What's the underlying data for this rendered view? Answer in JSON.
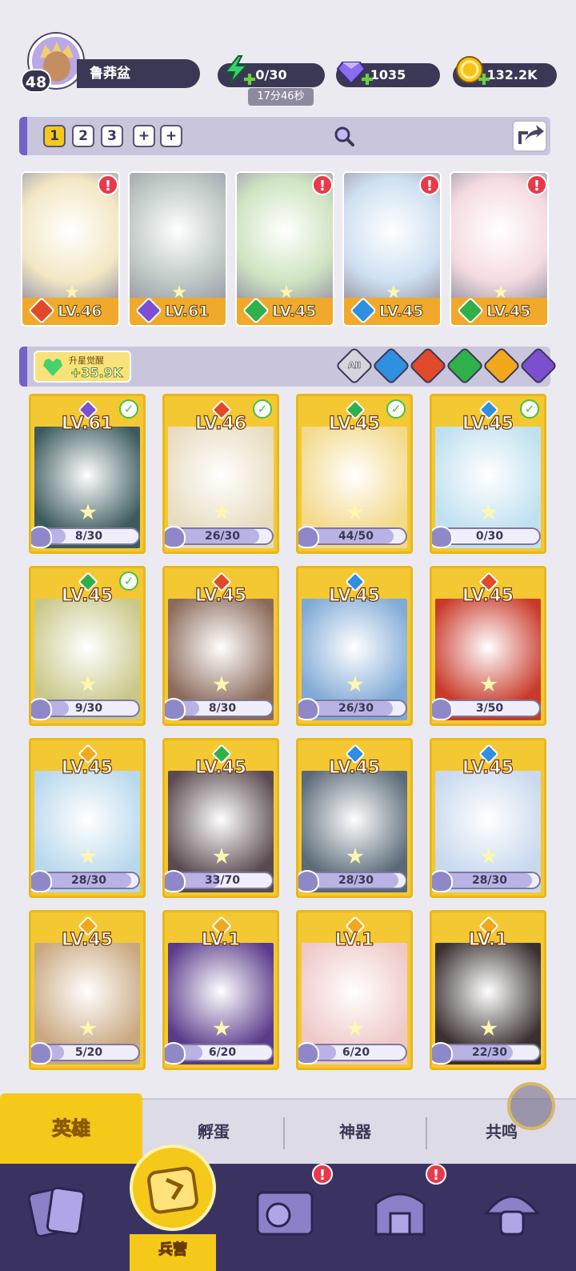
{
  "player": {
    "level": "48",
    "name": "鲁莽盆"
  },
  "resources": {
    "energy": "0/30",
    "energy_timer": "17分46秒",
    "gems": "1035",
    "gold": "132.2K"
  },
  "team_tabs": [
    "1",
    "2",
    "3",
    "+",
    "+"
  ],
  "team": [
    {
      "level": "LV.46",
      "element": "fire",
      "alert": true
    },
    {
      "level": "LV.61",
      "element": "dark",
      "alert": false
    },
    {
      "level": "LV.45",
      "element": "nature",
      "alert": true
    },
    {
      "level": "LV.45",
      "element": "water",
      "alert": true
    },
    {
      "level": "LV.45",
      "element": "nature",
      "alert": true
    }
  ],
  "awaken": {
    "label": "升星觉醒",
    "value": "+35.9K"
  },
  "filters": [
    "All",
    "water",
    "fire",
    "nature",
    "light",
    "dark"
  ],
  "heroes": [
    {
      "level": "LV.61",
      "element": "dark",
      "progress": "8/30",
      "fraction": 0.27,
      "checked": true
    },
    {
      "level": "LV.46",
      "element": "fire",
      "progress": "26/30",
      "fraction": 0.87,
      "checked": true
    },
    {
      "level": "LV.45",
      "element": "nature",
      "progress": "44/50",
      "fraction": 0.88,
      "checked": true
    },
    {
      "level": "LV.45",
      "element": "water",
      "progress": "0/30",
      "fraction": 0,
      "checked": true
    },
    {
      "level": "LV.45",
      "element": "nature",
      "progress": "9/30",
      "fraction": 0.3,
      "checked": true
    },
    {
      "level": "LV.45",
      "element": "fire",
      "progress": "8/30",
      "fraction": 0.27,
      "checked": false
    },
    {
      "level": "LV.45",
      "element": "water",
      "progress": "26/30",
      "fraction": 0.87,
      "checked": false
    },
    {
      "level": "LV.45",
      "element": "fire",
      "progress": "3/50",
      "fraction": 0.06,
      "checked": false
    },
    {
      "level": "LV.45",
      "element": "light",
      "progress": "28/30",
      "fraction": 0.93,
      "checked": false
    },
    {
      "level": "LV.45",
      "element": "nature",
      "progress": "33/70",
      "fraction": 0.47,
      "checked": false
    },
    {
      "level": "LV.45",
      "element": "water",
      "progress": "28/30",
      "fraction": 0.93,
      "checked": false
    },
    {
      "level": "LV.45",
      "element": "water",
      "progress": "28/30",
      "fraction": 0.93,
      "checked": false
    },
    {
      "level": "LV.45",
      "element": "light",
      "progress": "5/20",
      "fraction": 0.25,
      "checked": false
    },
    {
      "level": "LV.1",
      "element": "light",
      "progress": "6/20",
      "fraction": 0.3,
      "checked": false
    },
    {
      "level": "LV.1",
      "element": "light",
      "progress": "6/20",
      "fraction": 0.3,
      "checked": false
    },
    {
      "level": "LV.1",
      "element": "light",
      "progress": "22/30",
      "fraction": 0.73,
      "checked": false
    }
  ],
  "subtabs": [
    "英雄",
    "孵蛋",
    "神器",
    "共鸣"
  ],
  "bottom_nav": {
    "center_label": "兵营"
  },
  "colors": {
    "fire": "#e04a2a",
    "water": "#2f8fe0",
    "nature": "#2fb04a",
    "light": "#f2a81c",
    "dark": "#7a4fd0",
    "accent": "#f5c919",
    "panel": "#3b3855"
  }
}
